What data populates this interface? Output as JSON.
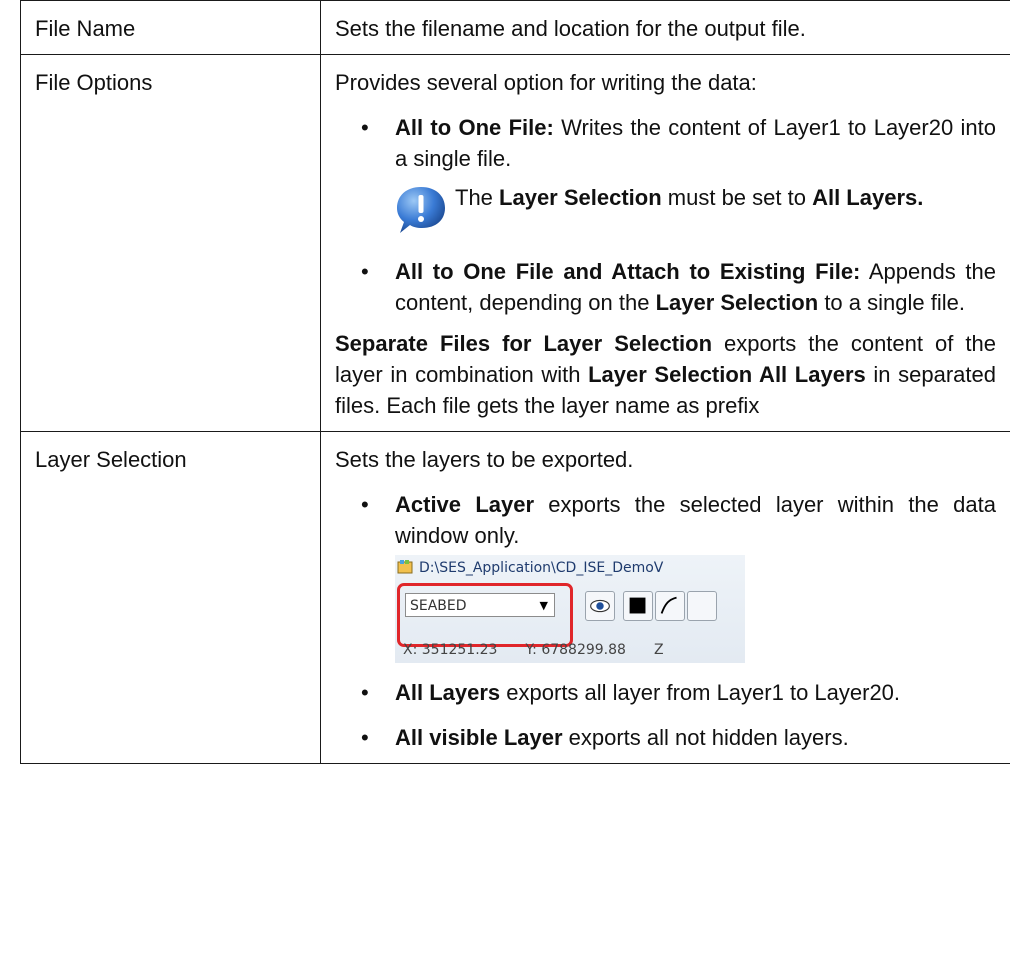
{
  "rows": [
    {
      "name": "File Name",
      "intro": "Sets the filename and location for the output file."
    },
    {
      "name": "File Options",
      "intro": "Provides several option for writing the data:",
      "option1_bold": "All to One File:",
      "option1_text": " Writes the content of Layer1 to Layer20 into a single file.",
      "note_pre": "The ",
      "note_bold1": "Layer Selection",
      "note_mid": " must be set to ",
      "note_bold2": "All Layers.",
      "option2_bold": "All to One File and Attach to Existing File:",
      "option2_text1": " Appends the content, depending on the ",
      "option2_bold2": "Layer Selection",
      "option2_text2": " to a single file.",
      "sep_bold1": "Separate Files for Layer Selection",
      "sep_text1": " exports the content of the layer in combination with ",
      "sep_bold2": "Layer Selection All Layers",
      "sep_text2": " in separated files. Each file gets the layer name as prefix"
    },
    {
      "name": "Layer Selection",
      "intro": "Sets the layers to be exported.",
      "opt1_bold": "Active Layer",
      "opt1_text": " exports the selected layer within the data window only.",
      "opt2_bold": "All Layers",
      "opt2_text": " exports all layer from Layer1 to Layer20.",
      "opt3_bold": "All visible Layer",
      "opt3_text": " exports all not hidden layers."
    }
  ],
  "screenshot": {
    "title": "D:\\SES_Application\\CD_ISE_DemoV",
    "combo_value": "SEABED",
    "x_coord": "X:  351251.23",
    "y_coord": "Y:  6788299.88",
    "z_label": "Z"
  },
  "bullet": "•",
  "icons": {
    "note": "info-exclamation-icon",
    "app": "app-icon",
    "eye": "eye-icon",
    "fill": "black-square-icon",
    "line": "line-tool-icon"
  },
  "colors": {
    "highlight": "#e0262a",
    "note_icon": "#3a7bd5"
  }
}
